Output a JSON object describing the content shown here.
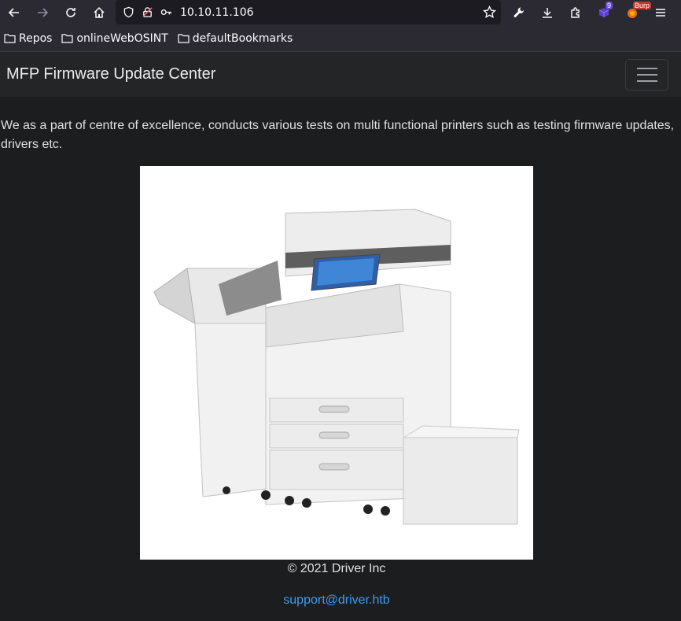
{
  "browser": {
    "url": "10.10.11.106",
    "extension_badge": "9",
    "burp_label": "Burp"
  },
  "bookmarks": [
    {
      "label": "Repos"
    },
    {
      "label": "onlineWebOSINT"
    },
    {
      "label": "defaultBookmarks"
    }
  ],
  "page": {
    "brand": "MFP Firmware Update Center",
    "intro": " We as a part of centre of excellence, conducts various tests on multi functional printers such as testing firmware updates, drivers etc.",
    "copyright": "© 2021 Driver Inc",
    "support_email": "support@driver.htb"
  },
  "colors": {
    "page_bg": "#1b1d1e",
    "navbar_bg": "#232526",
    "link": "#3d9cf0"
  }
}
